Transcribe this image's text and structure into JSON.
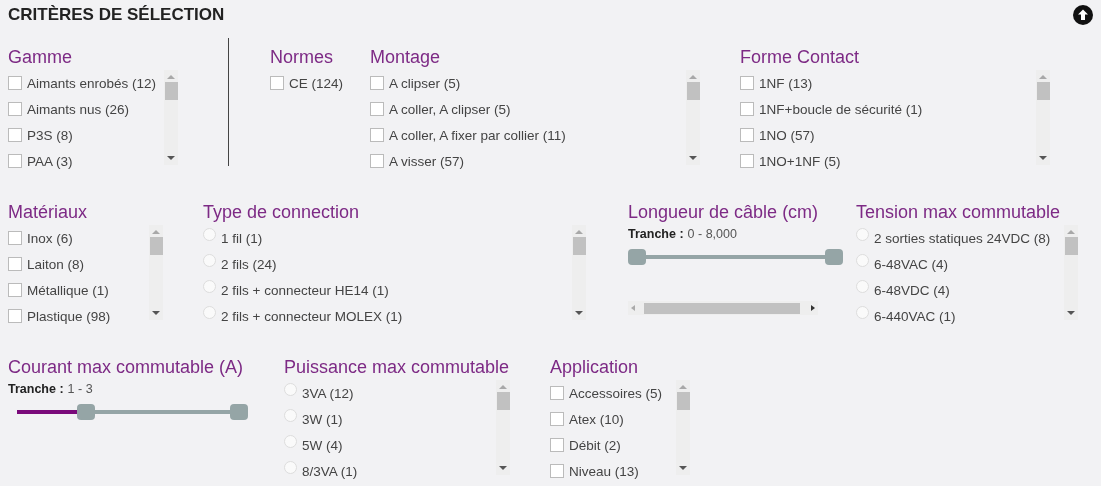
{
  "header": {
    "title": "CRITÈRES DE SÉLECTION"
  },
  "rows": [
    {
      "groups": [
        {
          "kind": "checkbox",
          "title": "Gamme",
          "items": [
            {
              "label": "Aimants enrobés (12)",
              "checked": false
            },
            {
              "label": "Aimants nus (26)",
              "checked": false
            },
            {
              "label": "P3S (8)",
              "checked": false
            },
            {
              "label": "PAA (3)",
              "checked": false
            }
          ]
        },
        {
          "kind": "checkbox",
          "title": "Normes",
          "items": [
            {
              "label": "CE (124)",
              "checked": false
            }
          ]
        },
        {
          "kind": "checkbox",
          "title": "Montage",
          "items": [
            {
              "label": "A clipser (5)",
              "checked": false
            },
            {
              "label": "A coller, A clipser (5)",
              "checked": false
            },
            {
              "label": "A coller, A fixer par collier (11)",
              "checked": false
            },
            {
              "label": "A visser (57)",
              "checked": false
            }
          ]
        },
        {
          "kind": "checkbox",
          "title": "Forme Contact",
          "items": [
            {
              "label": "1NF (13)",
              "checked": false
            },
            {
              "label": "1NF+boucle de sécurité (1)",
              "checked": false
            },
            {
              "label": "1NO (57)",
              "checked": false
            },
            {
              "label": "1NO+1NF (5)",
              "checked": false
            }
          ]
        }
      ]
    },
    {
      "groups": [
        {
          "kind": "checkbox",
          "title": "Matériaux",
          "items": [
            {
              "label": "Inox (6)",
              "checked": false
            },
            {
              "label": "Laiton (8)",
              "checked": false
            },
            {
              "label": "Métallique (1)",
              "checked": false
            },
            {
              "label": "Plastique (98)",
              "checked": false
            }
          ]
        },
        {
          "kind": "radio",
          "title": "Type de connection",
          "items": [
            {
              "label": "1 fil (1)",
              "selected": false
            },
            {
              "label": "2 fils (24)",
              "selected": false
            },
            {
              "label": "2 fils + connecteur HE14 (1)",
              "selected": false
            },
            {
              "label": "2 fils + connecteur MOLEX (1)",
              "selected": false
            }
          ]
        },
        {
          "kind": "range",
          "title": "Longueur de câble (cm)",
          "range_label": "Tranche :",
          "range_value": "0 - 8,000",
          "thumbs": [
            {
              "level": 0
            },
            {
              "level": 1
            }
          ]
        },
        {
          "kind": "radio",
          "title": "Tension max commutable",
          "items": [
            {
              "label": "2 sorties statiques 24VDC (8)",
              "selected": false
            },
            {
              "label": "6-48VAC (4)",
              "selected": false
            },
            {
              "label": "6-48VDC (4)",
              "selected": false
            },
            {
              "label": "6-440VAC (1)",
              "selected": false
            }
          ]
        }
      ]
    },
    {
      "groups": [
        {
          "kind": "range",
          "title": "Courant max commutable (A)",
          "range_label": "Tranche :",
          "range_value": "1 - 3",
          "thumbs": [
            {
              "level": 0.31
            },
            {
              "level": 1
            }
          ]
        },
        {
          "kind": "radio",
          "title": "Puissance max commutable",
          "items": [
            {
              "label": "3VA (12)",
              "selected": false
            },
            {
              "label": "3W (1)",
              "selected": false
            },
            {
              "label": "5W (4)",
              "selected": false
            },
            {
              "label": "8/3VA (1)",
              "selected": false
            }
          ]
        },
        {
          "kind": "checkbox",
          "title": "Application",
          "items": [
            {
              "label": "Accessoires (5)",
              "checked": false
            },
            {
              "label": "Atex (10)",
              "checked": false
            },
            {
              "label": "Débit (2)",
              "checked": false
            },
            {
              "label": "Niveau (13)",
              "checked": false
            }
          ]
        }
      ]
    }
  ]
}
